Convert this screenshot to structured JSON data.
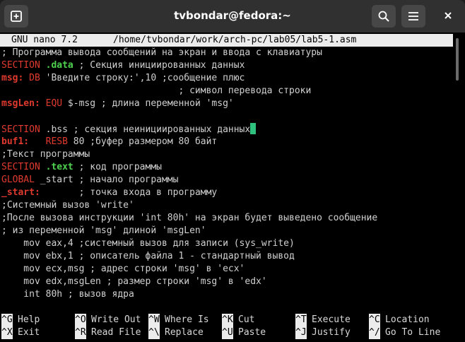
{
  "window": {
    "title": "tvbondar@fedora:~"
  },
  "icons": {
    "new_tab": "new-tab-icon",
    "search": "search-icon",
    "menu": "hamburger-menu-icon",
    "close": "close-icon"
  },
  "nano": {
    "version": "GNU nano 7.2",
    "path": "/home/tvbondar/work/arch-pc/lab05/lab5-1.asm"
  },
  "code": [
    "; Программа вывода сообщений на экран и ввода с клавиатуры",
    "SECTION .data ; Секция инициированных данных",
    "msg: DB 'Введите строку:',10 ;сообщение плюс",
    "                                ; символ перевода строки",
    "msgLen: EQU $-msg ; длина переменной 'msg'",
    "",
    "SECTION .bss ; секция неинициированных данных",
    "buf1:   RESB 80 ;буфер размером 80 байт",
    ";Текст программы",
    "SECTION .text ; код программы",
    "GLOBAL _start ; начало программы",
    "_start:       ; точка входа в программу",
    ";Системный вызов 'write'",
    ";После вызова инструкции 'int 80h' на экран будет выведено сообщение",
    "; из переменной 'msg' длиной 'msgLen'",
    "    mov eax,4 ;системный вызов для записи (sys_write)",
    "    mov ebx,1 ; описатель файла 1 - стандартный вывод",
    "    mov ecx,msg ; адрес строки 'msg' в 'ecx'",
    "    mov edx,msgLen ; размер строки 'msg' в 'edx'",
    "    int 80h ; вызов ядра"
  ],
  "shortcuts": [
    {
      "key": "^G",
      "label": "Help"
    },
    {
      "key": "^O",
      "label": "Write Out"
    },
    {
      "key": "^W",
      "label": "Where Is"
    },
    {
      "key": "^K",
      "label": "Cut"
    },
    {
      "key": "^T",
      "label": "Execute"
    },
    {
      "key": "^C",
      "label": "Location"
    },
    {
      "key": "^X",
      "label": "Exit"
    },
    {
      "key": "^R",
      "label": "Read File"
    },
    {
      "key": "^\\",
      "label": "Replace"
    },
    {
      "key": "^U",
      "label": "Paste"
    },
    {
      "key": "^J",
      "label": "Justify"
    },
    {
      "key": "^/",
      "label": "Go To Line"
    }
  ],
  "colors": {
    "keyword": "#e03a2f",
    "section_name": "#4fd150",
    "cursor": "#2ec27e",
    "titlebar": "#303030"
  }
}
